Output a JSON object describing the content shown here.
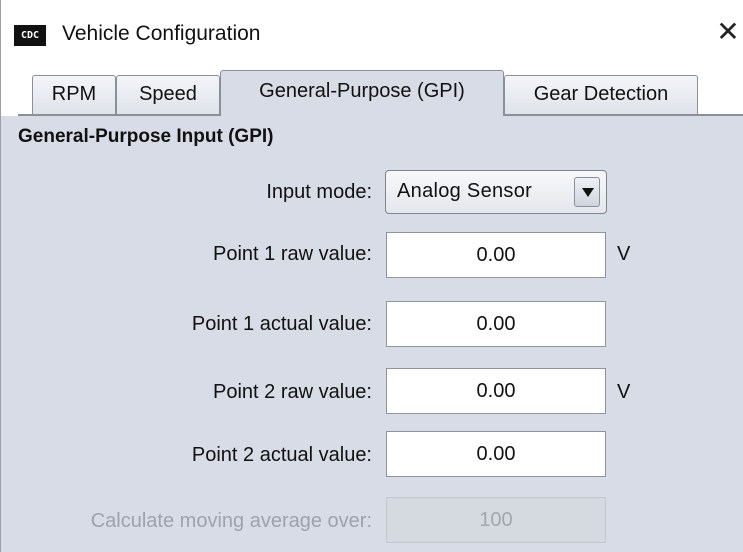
{
  "window": {
    "title": "Vehicle Configuration",
    "app_icon_text": "CDC",
    "close_glyph": "✕"
  },
  "tabs": [
    {
      "label": "RPM",
      "active": false
    },
    {
      "label": "Speed",
      "active": false
    },
    {
      "label": "General-Purpose (GPI)",
      "active": true
    },
    {
      "label": "Gear Detection",
      "active": false
    }
  ],
  "section": {
    "title": "General-Purpose Input (GPI)"
  },
  "input_mode": {
    "label": "Input mode:",
    "selected": "Analog Sensor"
  },
  "fields": [
    {
      "label": "Point 1 raw value:",
      "value": "0.00",
      "unit": "V",
      "enabled": true
    },
    {
      "label": "Point 1 actual value:",
      "value": "0.00",
      "unit": "",
      "enabled": true
    },
    {
      "label": "Point 2 raw value:",
      "value": "0.00",
      "unit": "V",
      "enabled": true
    },
    {
      "label": "Point 2 actual value:",
      "value": "0.00",
      "unit": "",
      "enabled": true
    },
    {
      "label": "Calculate moving average over:",
      "value": "100",
      "unit": "",
      "enabled": false
    }
  ],
  "colors": {
    "panel_background": "#d8dce6",
    "disabled_text": "#9ea3ab"
  }
}
